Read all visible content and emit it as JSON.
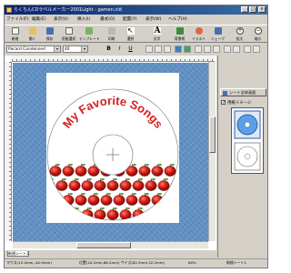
{
  "window": {
    "title": "らくちんCDラベルメーカー2001Light - gamen.cld"
  },
  "menu": [
    "ファイル(F)",
    "編集(E)",
    "表示(V)",
    "挿入(I)",
    "書式(O)",
    "配置(Y)",
    "表示(W)",
    "ヘルプ(H)"
  ],
  "toolbar": [
    {
      "label": "新規",
      "icon": "new-file-icon",
      "color": "#f4f4f4"
    },
    {
      "label": "開く",
      "icon": "open-folder-icon",
      "color": "#e8c05a"
    },
    {
      "label": "保存",
      "icon": "save-icon",
      "color": "#4a6fb0"
    },
    {
      "label": "用紙選択",
      "icon": "paper-select-icon",
      "color": "#f0f0f0"
    },
    {
      "label": "テンプレート",
      "icon": "template-icon",
      "color": "#7fb06a"
    },
    {
      "label": "印刷",
      "icon": "print-icon",
      "color": "#b8b8b8"
    },
    {
      "label": "選択",
      "icon": "pointer-icon",
      "color": "#ffffff"
    },
    {
      "label": "文字",
      "icon": "text-tool-icon",
      "color": "#ffffff"
    },
    {
      "label": "背景柄",
      "icon": "background-pattern-icon",
      "color": "#3c8c3c"
    },
    {
      "label": "イラスト",
      "icon": "illustration-icon",
      "color": "#d86a3a"
    },
    {
      "label": "シェープ",
      "icon": "shape-icon",
      "color": "#4a6fb0"
    },
    {
      "label": "拡大",
      "icon": "zoom-in-icon",
      "color": "#ffffff"
    },
    {
      "label": "縮小",
      "icon": "zoom-out-icon",
      "color": "#ffffff"
    }
  ],
  "format": {
    "font": "Pacard Condensed",
    "size": "40"
  },
  "label": {
    "title": "My Favorite Songs",
    "title_color": "#d62020"
  },
  "panel": {
    "full_screen_button": "シート全体画面",
    "paper_image_label": "用紙イメージ"
  },
  "tabs": [
    "新規シート1"
  ],
  "status": {
    "position": "マウス(15.4mm,-40.9mm)",
    "selection": "位置(10.2mm,68.2mm) サイズ(82.3mm,22.2mm)",
    "zoom": "80%",
    "sheet": "新規シート1"
  }
}
